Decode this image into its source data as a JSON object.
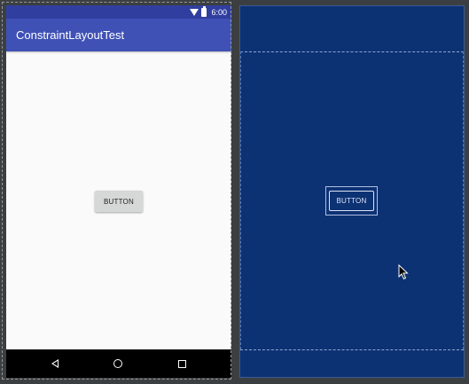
{
  "device": {
    "status_bar": {
      "time": "6:00",
      "icons": [
        "wifi-icon",
        "battery-icon"
      ],
      "color": "#303f9f"
    },
    "app_bar": {
      "title": "ConstraintLayoutTest",
      "color": "#3f51b5"
    },
    "content": {
      "button_label": "BUTTON",
      "background": "#fafafa"
    },
    "nav_bar": {
      "icons": [
        "back-icon",
        "home-icon",
        "recents-icon"
      ],
      "color": "#000000"
    }
  },
  "blueprint": {
    "button_label": "BUTTON",
    "background": "#0d3273"
  },
  "colors": {
    "editor_background": "#3c3f41"
  }
}
